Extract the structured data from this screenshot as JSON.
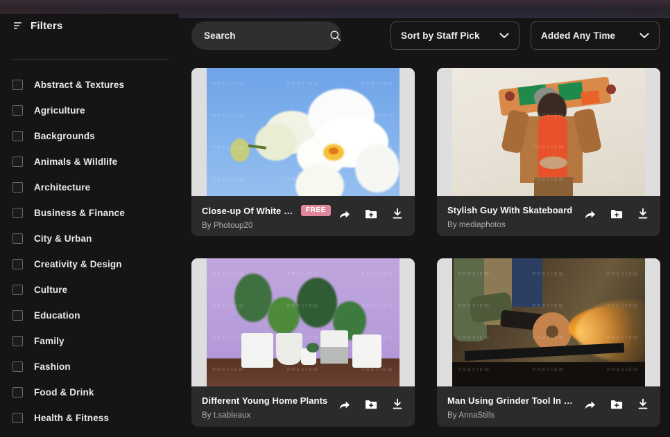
{
  "sidebar": {
    "title": "Filters",
    "filter_icon": "filter-lines-icon",
    "categories": [
      "Abstract & Textures",
      "Agriculture",
      "Backgrounds",
      "Animals & Wildlife",
      "Architecture",
      "Business & Finance",
      "City & Urban",
      "Creativity & Design",
      "Culture",
      "Education",
      "Family",
      "Fashion",
      "Food & Drink",
      "Health & Fitness"
    ]
  },
  "topbar": {
    "search": {
      "value": "",
      "placeholder": "Search",
      "icon": "search-icon"
    },
    "sort_select": {
      "value": "Sort by Staff Pick",
      "icon": "chevron-down-icon"
    },
    "time_select": {
      "value": "Added Any Time",
      "icon": "chevron-down-icon"
    }
  },
  "watermark_text": "PREVIEW",
  "actions": {
    "share": "share-icon",
    "add_to_collection": "folder-plus-icon",
    "download": "download-icon"
  },
  "colors": {
    "page_background": "#151515",
    "card_background": "#2b2b2b",
    "free_badge": "#e0879c",
    "search_background": "#2f2f2f",
    "text_primary": "#fafafa",
    "text_secondary": "#b0b0b0",
    "border": "#4a4a4a"
  },
  "cards": [
    {
      "title": "Close-up Of White Orchid Fl...",
      "author": "By Photoup20",
      "badge": "FREE",
      "has_badge": true,
      "art": "art-orchid",
      "letterbox": true
    },
    {
      "title": "Stylish Guy With Skateboard",
      "author": "By mediaphotos",
      "badge": "",
      "has_badge": false,
      "art": "art-skate",
      "letterbox": true
    },
    {
      "title": "Different Young Home Plants",
      "author": "By t.sableaux",
      "badge": "",
      "has_badge": false,
      "art": "art-plants",
      "letterbox": true
    },
    {
      "title": "Man Using Grinder Tool In Workshop",
      "author": "By AnnaStills",
      "badge": "",
      "has_badge": false,
      "art": "art-grinder",
      "letterbox": true
    }
  ]
}
